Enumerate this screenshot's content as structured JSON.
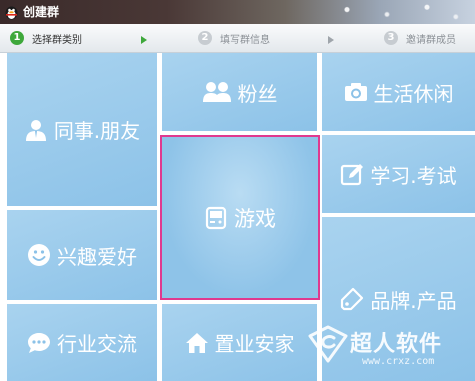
{
  "window": {
    "title": "创建群",
    "app_icon": "penguin-icon"
  },
  "steps": [
    {
      "number": "1",
      "label": "选择群类别",
      "state": "active"
    },
    {
      "number": "2",
      "label": "填写群信息",
      "state": "inactive"
    },
    {
      "number": "3",
      "label": "邀请群成员",
      "state": "inactive"
    }
  ],
  "categories": [
    {
      "id": "colleague-friend",
      "label": "同事.朋友",
      "icon": "person-icon"
    },
    {
      "id": "fans",
      "label": "粉丝",
      "icon": "people-icon"
    },
    {
      "id": "life-leisure",
      "label": "生活休闲",
      "icon": "camera-icon"
    },
    {
      "id": "game",
      "label": "游戏",
      "icon": "gamepad-icon",
      "selected": true
    },
    {
      "id": "study-exam",
      "label": "学习.考试",
      "icon": "pencil-icon"
    },
    {
      "id": "interests",
      "label": "兴趣爱好",
      "icon": "smiley-icon"
    },
    {
      "id": "brand-product",
      "label": "品牌.产品",
      "icon": "tag-icon"
    },
    {
      "id": "industry",
      "label": "行业交流",
      "icon": "chat-bubble-icon"
    },
    {
      "id": "real-estate",
      "label": "置业安家",
      "icon": "home-icon"
    }
  ],
  "watermark": {
    "brand": "超人软件",
    "url": "www.crxz.com"
  },
  "colors": {
    "tile": "#8cc2e8",
    "selected_border": "#e0398f",
    "step_active": "#3ea83b"
  }
}
